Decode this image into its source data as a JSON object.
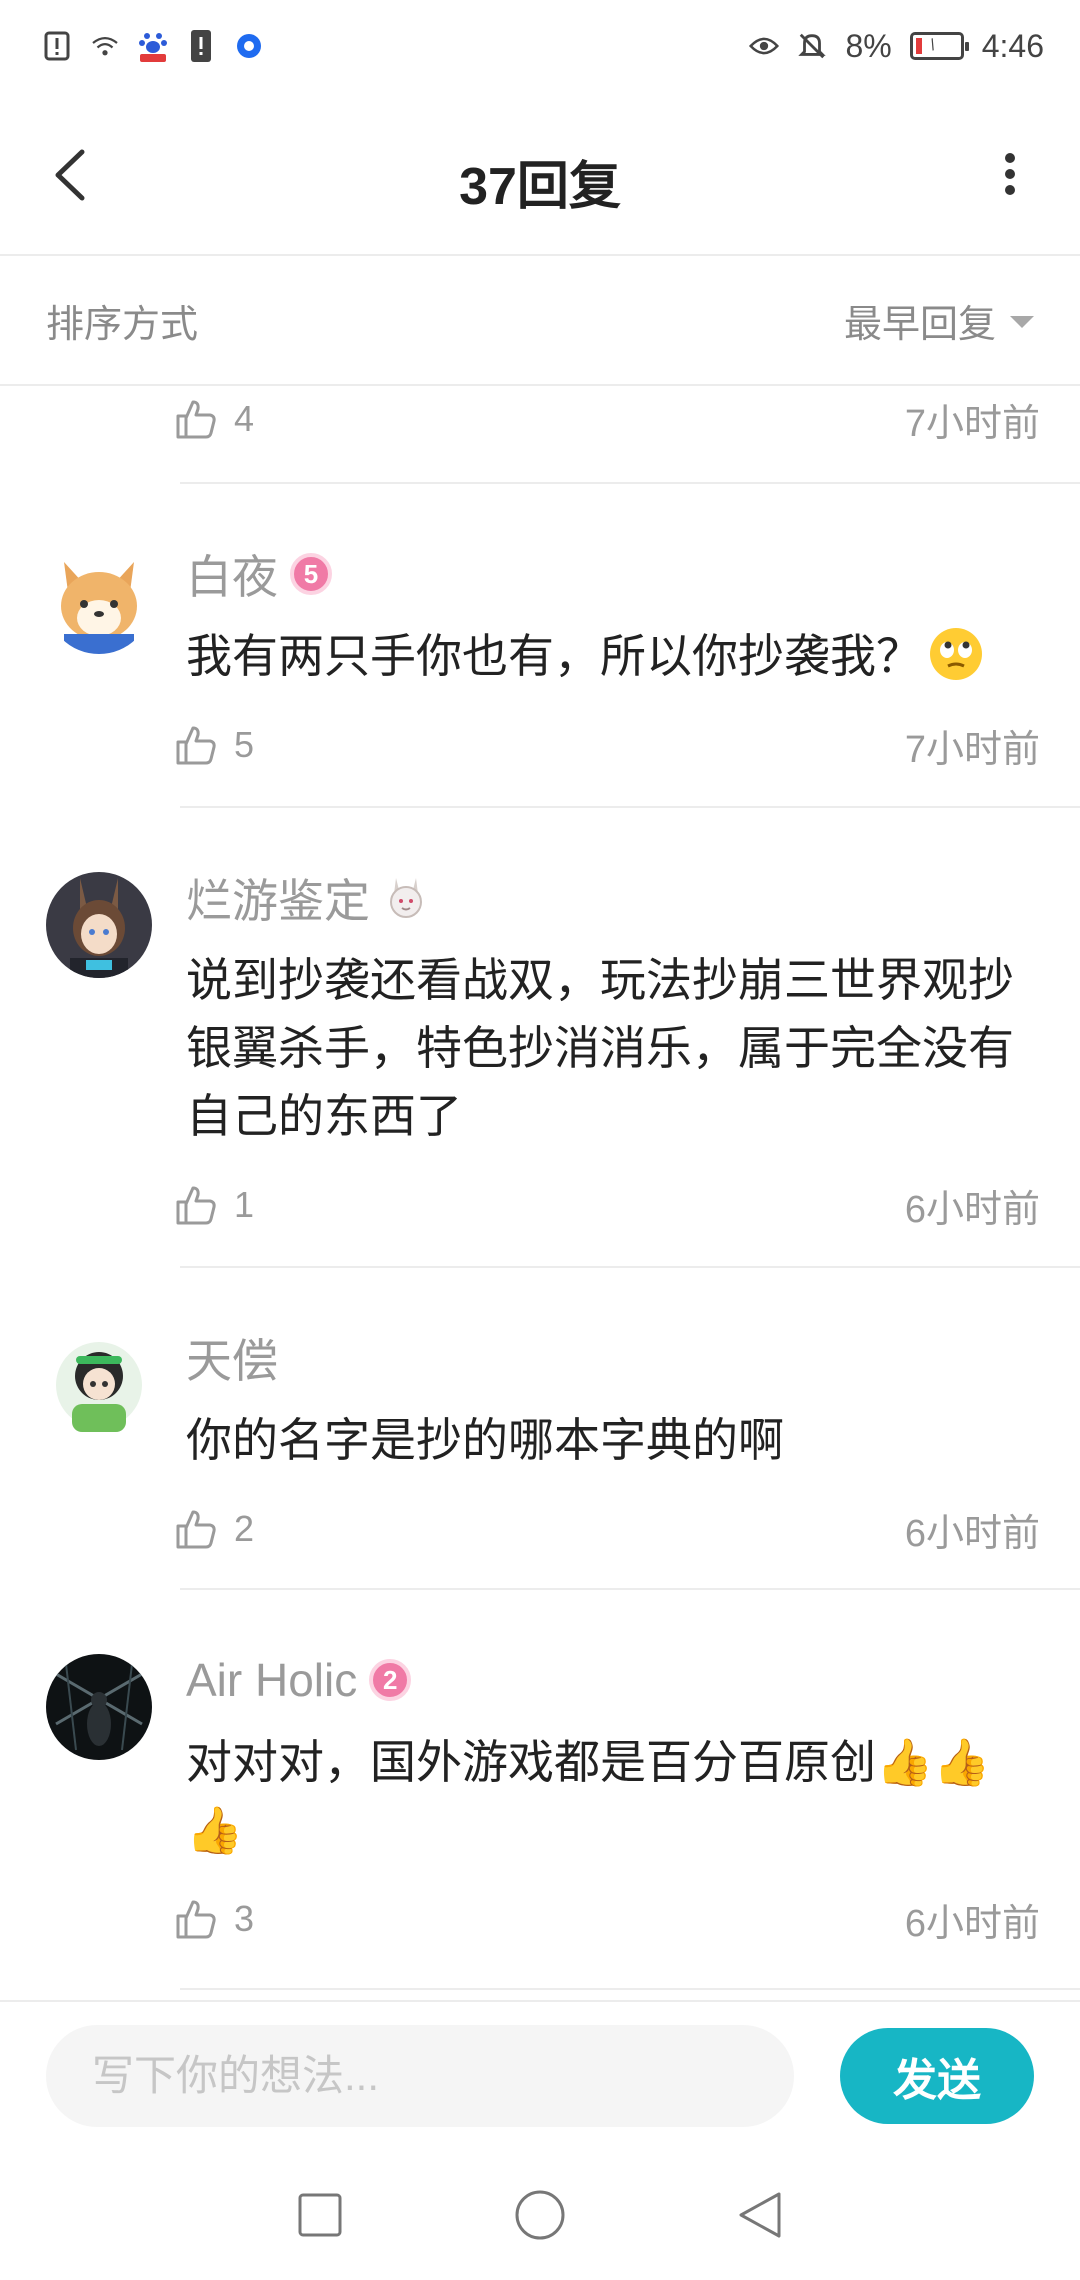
{
  "status_bar": {
    "icons_left": [
      "alert-icon",
      "wifi-icon",
      "baidu-icon",
      "sim-alert-icon",
      "app-icon"
    ],
    "icons_right": [
      "eye-icon",
      "bell-muted-icon",
      "battery-icon"
    ],
    "battery": "8%",
    "time": "4:46"
  },
  "header": {
    "title": "37回复",
    "back_icon": "chevron-left-icon",
    "more_icon": "more-vertical-icon"
  },
  "sort": {
    "label": "排序方式",
    "value": "最早回复"
  },
  "comments": [
    {
      "likes": "4",
      "time": "7小时前"
    },
    {
      "name": "白夜",
      "badge": "5",
      "text": "我有两只手你也有，所以你抄袭我？",
      "emoji": "eye-roll-emoji",
      "likes": "5",
      "time": "7小时前"
    },
    {
      "name": "烂游鉴定",
      "text": "说到抄袭还看战双，玩法抄崩三世界观抄银翼杀手，特色抄消消乐，属于完全没有自己的东西了",
      "likes": "1",
      "time": "6小时前"
    },
    {
      "name": "天偿",
      "text": "你的名字是抄的哪本字典的啊",
      "likes": "2",
      "time": "6小时前"
    },
    {
      "name": "Air Holic",
      "badge": "2",
      "text": "对对对，国外游戏都是百分百原创👍👍👍",
      "likes": "3",
      "time": "6小时前"
    }
  ],
  "input_bar": {
    "placeholder": "写下你的想法...",
    "send_label": "发送"
  },
  "colors": {
    "accent": "#17b6c5",
    "badge": "#f07aa6",
    "muted_text": "#9a9a9a"
  }
}
